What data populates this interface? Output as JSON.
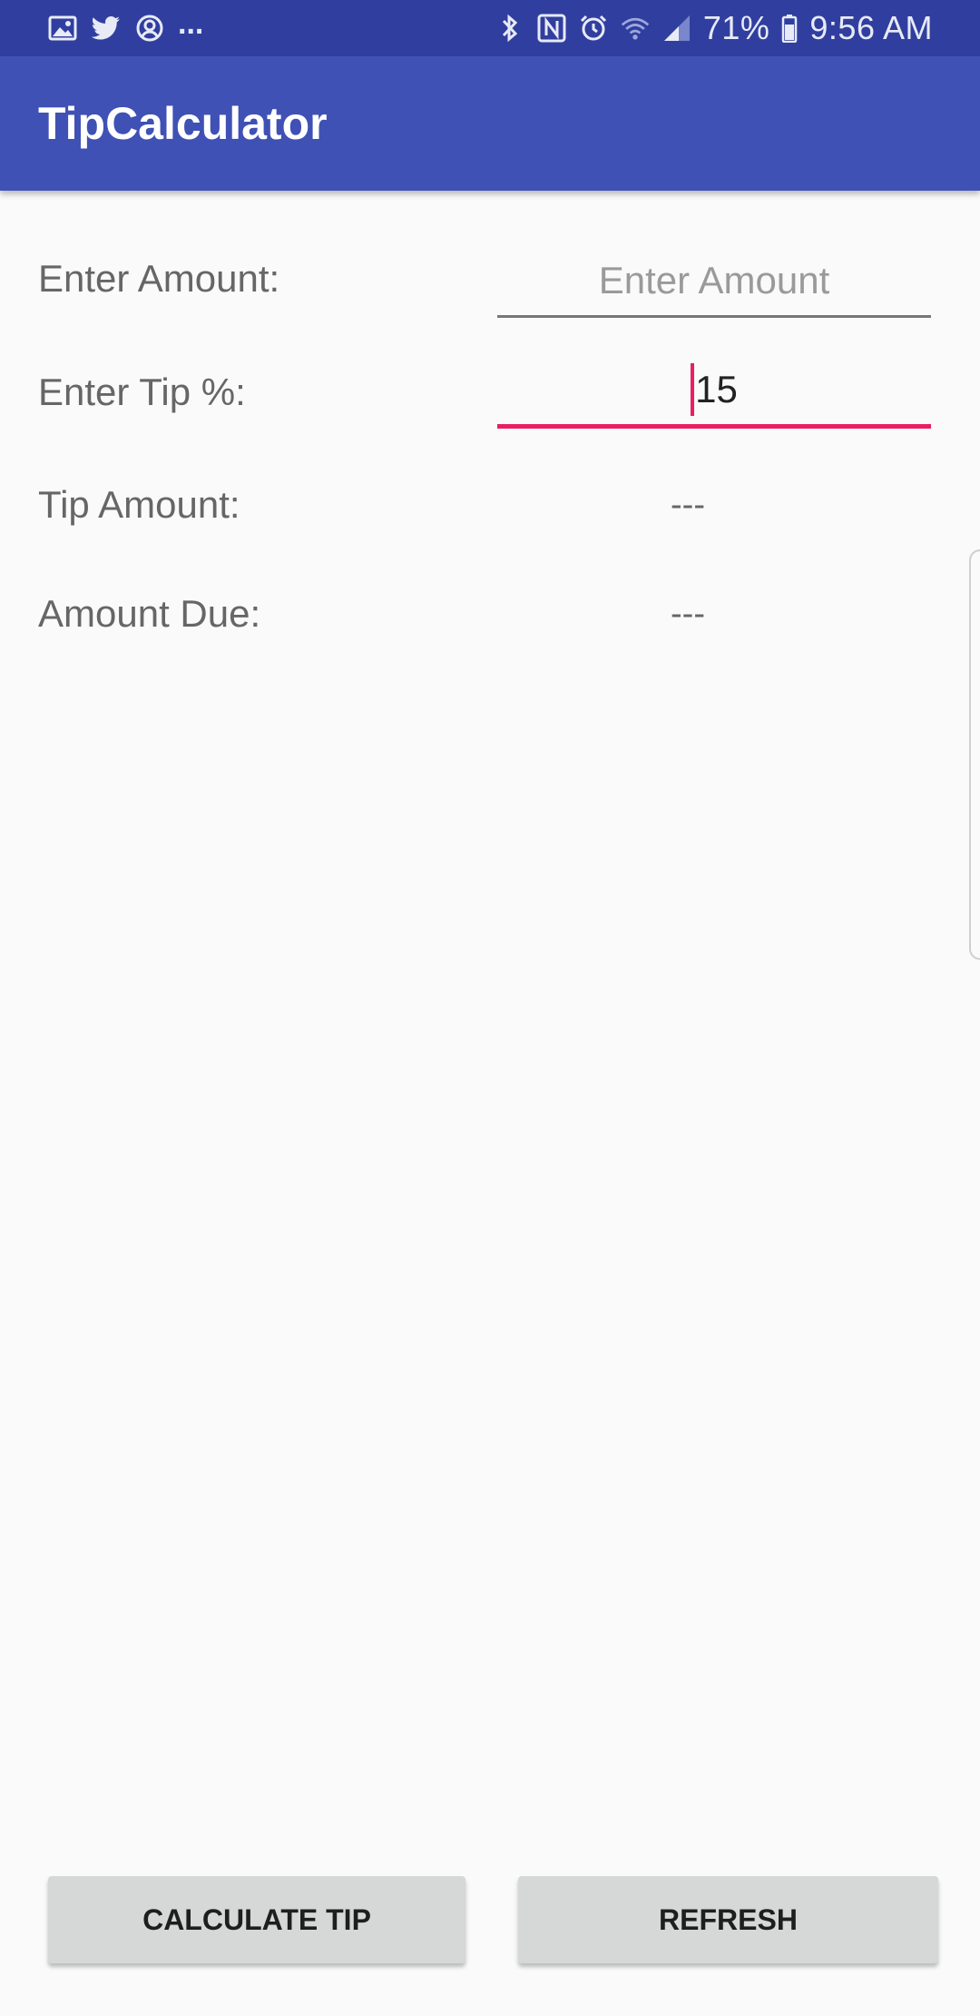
{
  "status_bar": {
    "left_icons": [
      "image-icon",
      "twitter-icon",
      "account-circle-icon"
    ],
    "overflow": "...",
    "right_icons": [
      "bluetooth-icon",
      "nfc-icon",
      "alarm-icon",
      "wifi-icon",
      "signal-icon"
    ],
    "battery_percent": "71%",
    "time": "9:56 AM"
  },
  "app_bar": {
    "title": "TipCalculator"
  },
  "form": {
    "amount_label": "Enter Amount:",
    "amount_placeholder": "Enter Amount",
    "amount_value": "",
    "tip_label": "Enter Tip %:",
    "tip_value": "15",
    "tip_amount_label": "Tip Amount:",
    "tip_amount_value": "---",
    "amount_due_label": "Amount Due:",
    "amount_due_value": "---"
  },
  "buttons": {
    "calculate_label": "CALCULATE TIP",
    "refresh_label": "REFRESH"
  },
  "colors": {
    "status_bar": "#303f9f",
    "app_bar": "#3f51b5",
    "accent": "#e91e63",
    "background": "#fafafa",
    "button": "#d6d7d7"
  }
}
